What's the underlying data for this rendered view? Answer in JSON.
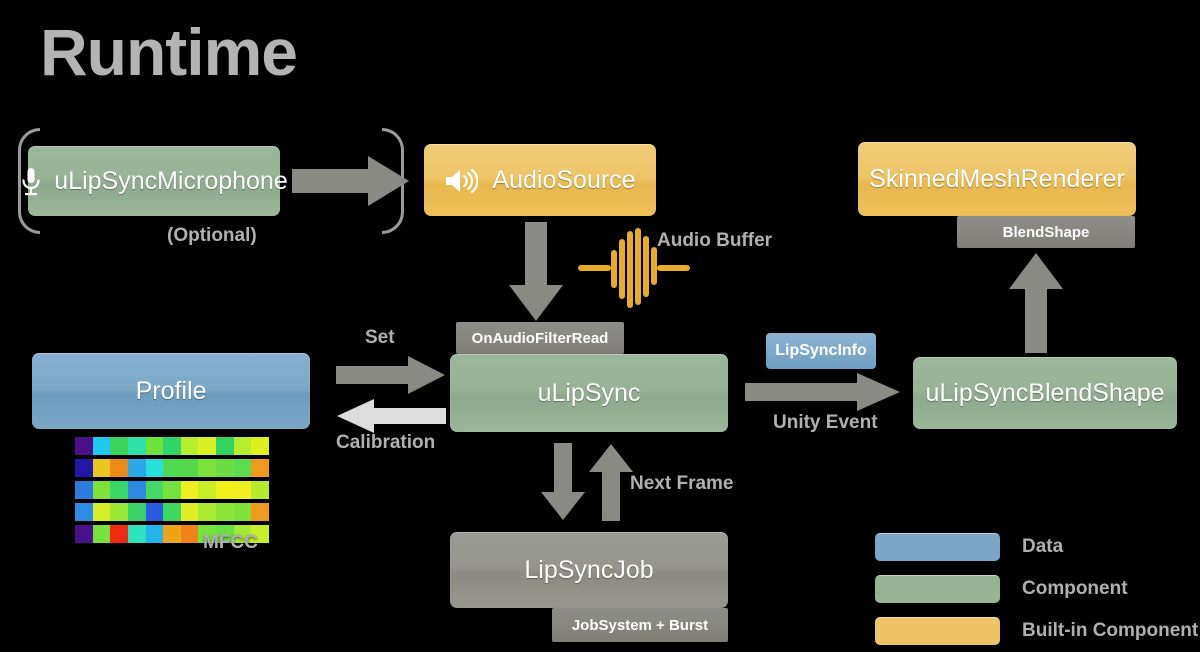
{
  "title": "Runtime",
  "nodes": {
    "microphone": {
      "label": "uLipSyncMicrophone",
      "icon": "microphone-icon",
      "note": "(Optional)"
    },
    "audio_source": {
      "label": "AudioSource",
      "icon": "speaker-icon"
    },
    "skinned_mesh_renderer": {
      "label": "SkinnedMeshRenderer",
      "tab": "BlendShape"
    },
    "ulipsync": {
      "label": "uLipSync",
      "tab": "OnAudioFilterRead"
    },
    "profile": {
      "label": "Profile",
      "note": "MFCC"
    },
    "ulipsync_blendshape": {
      "label": "uLipSyncBlendShape"
    },
    "lipsyncjob": {
      "label": "LipSyncJob",
      "tab": "JobSystem + Burst"
    }
  },
  "badges": {
    "lipsyncinfo": "LipSyncInfo"
  },
  "edges": {
    "mic_to_audiosource": "",
    "audio_buffer": "Audio Buffer",
    "set": "Set",
    "calibration": "Calibration",
    "unity_event": "Unity Event",
    "next_frame": "Next Frame"
  },
  "legend": [
    {
      "label": "Data",
      "color": "#7ba7c6"
    },
    {
      "label": "Component",
      "color": "#96b394"
    },
    {
      "label": "Built-in Component",
      "color": "#eec467"
    }
  ],
  "colors": {
    "background": "#000000",
    "data": "#7ba7c6",
    "component": "#96b394",
    "builtin": "#eec467",
    "gray_tab": "#87877f",
    "arrow": "#8a8a85",
    "arrow_light": "#dcdcdc",
    "caption": "#b0b0b0",
    "title": "#b3b3b3",
    "waveform": "#e8ad28"
  },
  "mfcc": {
    "rows": [
      [
        "#4b0f8c",
        "#20c8f0",
        "#3ad45a",
        "#2ee0a8",
        "#6ee23a",
        "#2fd46a",
        "#b9ee2c",
        "#d8f024",
        "#30d45e",
        "#b6ee2e",
        "#ddf01e"
      ],
      [
        "#2416a8",
        "#e8c820",
        "#f08a18",
        "#2ba8e8",
        "#2ae0dc",
        "#4fdc54",
        "#58d84e",
        "#7ce23a",
        "#6ade44",
        "#5cdc50",
        "#f09a1c"
      ],
      [
        "#2a7ce0",
        "#7ee238",
        "#38d862",
        "#3088e4",
        "#45d868",
        "#74e23c",
        "#eef020",
        "#c8ee28",
        "#f4f01c",
        "#eef022",
        "#b4ec30"
      ],
      [
        "#2a8ce4",
        "#d6ee26",
        "#9ae834",
        "#3ad06e",
        "#2a5ce0",
        "#3ed860",
        "#e0ee24",
        "#a8ea32",
        "#8ce636",
        "#7ee23a",
        "#f09a1c"
      ],
      [
        "#4b0f8c",
        "#74e23c",
        "#f02a12",
        "#2ee2c0",
        "#24b4ec",
        "#f0a41a",
        "#f0821a",
        "#78e23c",
        "#6ade44",
        "#a2ea34",
        "#c6ee2a"
      ]
    ]
  }
}
